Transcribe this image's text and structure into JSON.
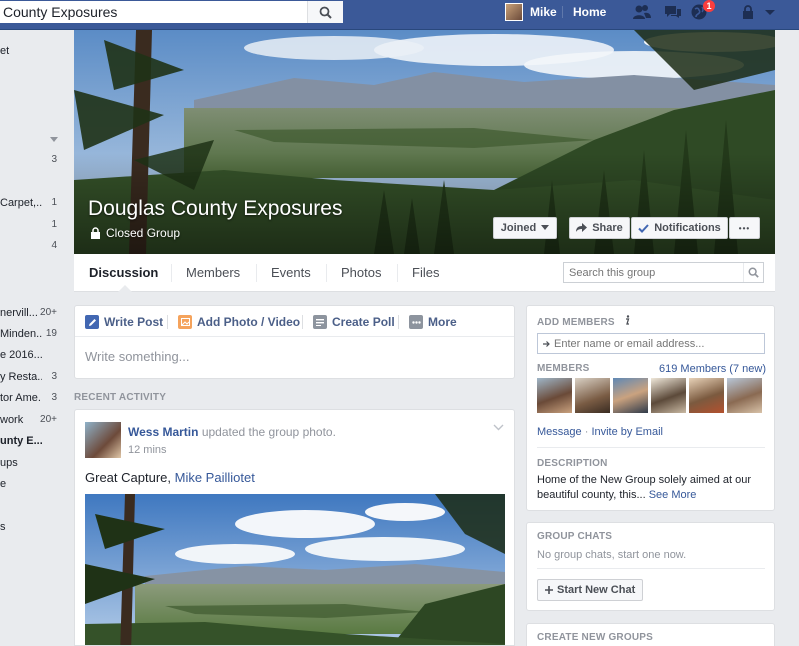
{
  "topbar": {
    "search_value": "County Exposures",
    "user_name": "Mike",
    "home_label": "Home",
    "notifications_count": "1",
    "icons": [
      "search-icon",
      "friend-requests-icon",
      "messages-icon",
      "notifications-globe-icon",
      "privacy-lock-icon",
      "account-menu-caret-icon"
    ]
  },
  "left_sidebar": [
    {
      "label": "et",
      "count": ""
    },
    {
      "label": "",
      "count": "3"
    },
    {
      "label": "Carpet,...",
      "count": "1"
    },
    {
      "label": "",
      "count": "1"
    },
    {
      "label": "",
      "count": "4"
    },
    {
      "label": "nervill...",
      "count": "20+"
    },
    {
      "label": "Minden...",
      "count": "19"
    },
    {
      "label": "e 2016...",
      "count": ""
    },
    {
      "label": "y Resta...",
      "count": "3"
    },
    {
      "label": "tor Ame...",
      "count": "3"
    },
    {
      "label": "work",
      "count": "20+"
    },
    {
      "label": "unty E...",
      "count": ""
    },
    {
      "label": "ups",
      "count": ""
    },
    {
      "label": "e",
      "count": ""
    },
    {
      "label": "s",
      "count": ""
    }
  ],
  "cover": {
    "group_name": "Douglas County Exposures",
    "privacy": "Closed Group",
    "joined_label": "Joined",
    "share_label": "Share",
    "notifications_label": "Notifications",
    "more_label": "•••"
  },
  "group_nav": {
    "tabs": [
      "Discussion",
      "Members",
      "Events",
      "Photos",
      "Files"
    ],
    "search_placeholder": "Search this group"
  },
  "composer": {
    "write_post": "Write Post",
    "add_photo": "Add Photo / Video",
    "create_poll": "Create Poll",
    "more": "More",
    "placeholder": "Write something..."
  },
  "recent_activity_label": "RECENT ACTIVITY",
  "post": {
    "author": "Wess Martin",
    "action": "updated the group photo.",
    "time": "12 mins",
    "text": "Great Capture,",
    "tagged": "Mike Pailliotet"
  },
  "add_members": {
    "heading": "ADD MEMBERS",
    "placeholder": "Enter name or email address...",
    "members_heading": "MEMBERS",
    "members_count": "619 Members (7 new)",
    "message_link": "Message",
    "invite_link": "Invite by Email",
    "link_sep": "·",
    "description_heading": "DESCRIPTION",
    "description": "Home of the New Group solely aimed at our beautiful county, this...",
    "see_more": "See More"
  },
  "group_chats": {
    "heading": "GROUP CHATS",
    "empty_text": "No group chats, start one now.",
    "start_chat": "Start New Chat"
  },
  "create_groups": {
    "heading": "CREATE NEW GROUPS"
  }
}
